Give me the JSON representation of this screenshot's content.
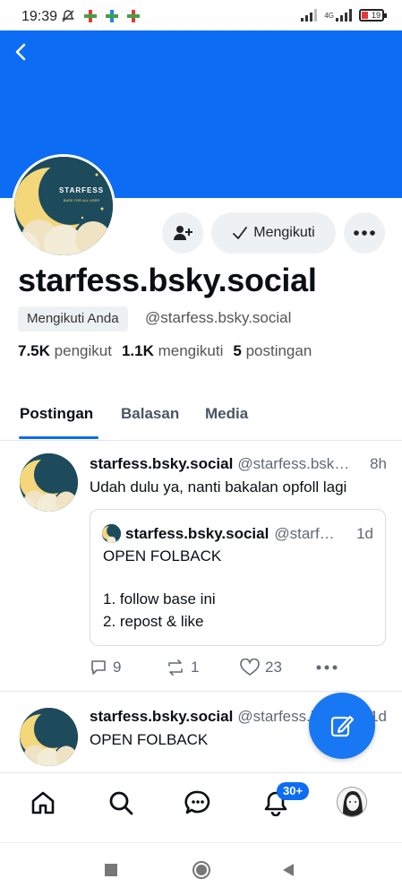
{
  "status_bar": {
    "time": "19:39",
    "network": "4G",
    "battery": "19"
  },
  "profile": {
    "display_name": "starfess.bsky.social",
    "follows_you_badge": "Mengikuti Anda",
    "handle": "@starfess.bsky.social",
    "avatar_text": "STARFESS",
    "avatar_subtext": "BASE FOR ALL USER",
    "stats": {
      "followers_count": "7.5K",
      "followers_label": "pengikut",
      "following_count": "1.1K",
      "following_label": "mengikuti",
      "posts_count": "5",
      "posts_label": "postingan"
    },
    "follow_button_label": "Mengikuti"
  },
  "tabs": [
    {
      "label": "Postingan",
      "active": true
    },
    {
      "label": "Balasan",
      "active": false
    },
    {
      "label": "Media",
      "active": false
    }
  ],
  "posts": [
    {
      "name": "starfess.bsky.social",
      "handle": "@starfess.bsky.social",
      "time": "8h",
      "text": "Udah dulu ya, nanti bakalan opfoll lagi",
      "quote": {
        "name": "starfess.bsky.social",
        "handle": "@starfess.bsky.social",
        "time": "1d",
        "line1": "OPEN FOLBACK",
        "line2": "1. follow base ini",
        "line3": "2. repost & like"
      },
      "replies": "9",
      "reposts": "1",
      "likes": "23"
    },
    {
      "name": "starfess.bsky.social",
      "handle": "@starfess.bsky.social",
      "time": "1d",
      "text": "OPEN FOLBACK"
    }
  ],
  "nav": {
    "notifications_badge": "30+"
  },
  "colors": {
    "accent": "#0c6cf4",
    "banner": "#0c6cf4",
    "avatar_bg": "#1d4b5c",
    "moon": "#f3d77a"
  }
}
